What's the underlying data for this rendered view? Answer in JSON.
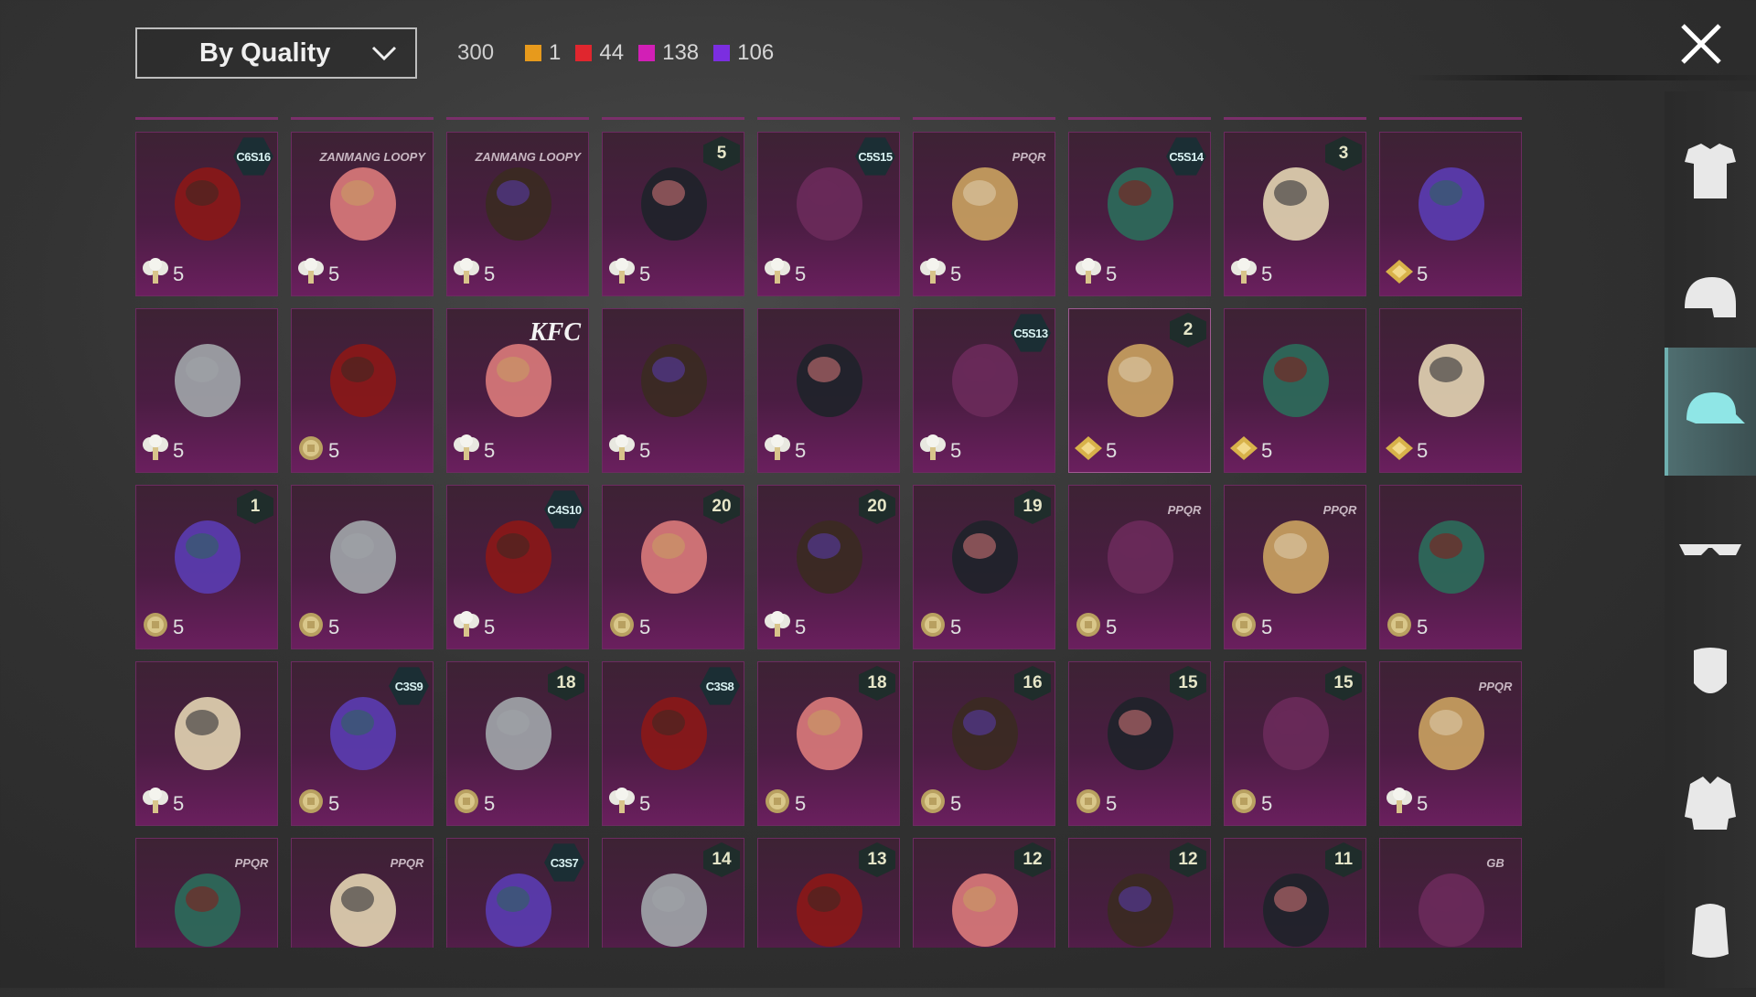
{
  "header": {
    "sort_label": "By Quality",
    "total": "300",
    "qualities": [
      {
        "color": "#e79a1c",
        "count": "1"
      },
      {
        "color": "#e0262e",
        "count": "44"
      },
      {
        "color": "#d21fb6",
        "count": "138"
      },
      {
        "color": "#7b2ee0",
        "count": "106"
      }
    ]
  },
  "items": [
    {
      "badge": "C6S16",
      "badge_type": "hex",
      "cost": "5",
      "currency": "tree",
      "icon": "red-hair-icon"
    },
    {
      "badge": "ZANMANG LOOPY",
      "badge_type": "brand",
      "cost": "5",
      "currency": "tree",
      "icon": "beaver-mask-icon"
    },
    {
      "badge": "ZANMANG LOOPY",
      "badge_type": "brand",
      "cost": "5",
      "currency": "tree",
      "icon": "beaver-mask-icon"
    },
    {
      "badge": "5",
      "badge_type": "lvl",
      "cost": "5",
      "currency": "tree",
      "icon": "long-hair-bow-icon"
    },
    {
      "badge": "C5S15",
      "badge_type": "hex",
      "cost": "5",
      "currency": "tree",
      "icon": "black-cap-icon"
    },
    {
      "badge": "PPQR",
      "badge_type": "brand",
      "cost": "5",
      "currency": "tree",
      "icon": "dark-hair-icon"
    },
    {
      "badge": "C5S14",
      "badge_type": "hex",
      "cost": "5",
      "currency": "tree",
      "icon": "purple-hair-icon"
    },
    {
      "badge": "3",
      "badge_type": "lvl",
      "cost": "5",
      "currency": "tree",
      "icon": "jester-hat-icon"
    },
    {
      "badge": "",
      "badge_type": "none",
      "cost": "5",
      "currency": "gem",
      "icon": "duck-head-arrow-icon"
    },
    {
      "badge": "",
      "badge_type": "none",
      "cost": "5",
      "currency": "tree",
      "icon": "wide-brim-hat-icon"
    },
    {
      "badge": "",
      "badge_type": "none",
      "cost": "5",
      "currency": "coin",
      "icon": "white-hair-icon"
    },
    {
      "badge": "KFC",
      "badge_type": "brand-kfc",
      "cost": "5",
      "currency": "tree",
      "icon": "chicken-cap-icon"
    },
    {
      "badge": "",
      "badge_type": "none",
      "cost": "5",
      "currency": "tree",
      "icon": "flower-hair-icon"
    },
    {
      "badge": "",
      "badge_type": "none",
      "cost": "5",
      "currency": "tree",
      "icon": "spiked-helmet-icon"
    },
    {
      "badge": "C5S13",
      "badge_type": "hex",
      "cost": "5",
      "currency": "tree",
      "icon": "green-beanie-icon"
    },
    {
      "badge": "2",
      "badge_type": "lvl",
      "cost": "5",
      "currency": "gem",
      "icon": "blonde-nurse-hat-icon"
    },
    {
      "badge": "",
      "badge_type": "none",
      "cost": "5",
      "currency": "gem",
      "icon": "goose-mask-icon"
    },
    {
      "badge": "",
      "badge_type": "none",
      "cost": "5",
      "currency": "gem",
      "icon": "potato-mask-icon"
    },
    {
      "badge": "1",
      "badge_type": "lvl",
      "cost": "5",
      "currency": "coin",
      "icon": "rainbow-hair-icon"
    },
    {
      "badge": "",
      "badge_type": "none",
      "cost": "5",
      "currency": "coin",
      "icon": "red-bow-headband-icon"
    },
    {
      "badge": "C4S10",
      "badge_type": "hex",
      "cost": "5",
      "currency": "tree",
      "icon": "green-helmet-icon"
    },
    {
      "badge": "20",
      "badge_type": "lvl",
      "cost": "5",
      "currency": "coin",
      "icon": "bunny-hair-icon"
    },
    {
      "badge": "20",
      "badge_type": "lvl",
      "cost": "5",
      "currency": "tree",
      "icon": "gold-mask-icon"
    },
    {
      "badge": "19",
      "badge_type": "lvl",
      "cost": "5",
      "currency": "coin",
      "icon": "black-bun-hair-icon"
    },
    {
      "badge": "PPQR",
      "badge_type": "brand",
      "cost": "5",
      "currency": "coin",
      "icon": "potato-head-icon"
    },
    {
      "badge": "PPQR",
      "badge_type": "brand",
      "cost": "5",
      "currency": "coin",
      "icon": "red-bob-hair-icon"
    },
    {
      "badge": "",
      "badge_type": "none",
      "cost": "5",
      "currency": "coin",
      "icon": "blue-demon-mask-icon"
    },
    {
      "badge": "",
      "badge_type": "none",
      "cost": "5",
      "currency": "tree",
      "icon": "luchador-mask-icon"
    },
    {
      "badge": "C3S9",
      "badge_type": "hex",
      "cost": "5",
      "currency": "coin",
      "icon": "purple-bandana-icon"
    },
    {
      "badge": "18",
      "badge_type": "lvl",
      "cost": "5",
      "currency": "coin",
      "icon": "uncle-sam-hat-icon"
    },
    {
      "badge": "C3S8",
      "badge_type": "hex",
      "cost": "5",
      "currency": "tree",
      "icon": "knit-cap-icon"
    },
    {
      "badge": "18",
      "badge_type": "lvl",
      "cost": "5",
      "currency": "coin",
      "icon": "black-hair-icon"
    },
    {
      "badge": "16",
      "badge_type": "lvl",
      "cost": "5",
      "currency": "coin",
      "icon": "peacock-hair-icon"
    },
    {
      "badge": "15",
      "badge_type": "lvl",
      "cost": "5",
      "currency": "coin",
      "icon": "bird-mask-icon"
    },
    {
      "badge": "15",
      "badge_type": "lvl",
      "cost": "5",
      "currency": "coin",
      "icon": "dreadlock-hair-icon"
    },
    {
      "badge": "PPQR",
      "badge_type": "brand",
      "cost": "5",
      "currency": "tree",
      "icon": "bomb-helmet-icon"
    },
    {
      "badge": "PPQR",
      "badge_type": "brand",
      "cost": "",
      "currency": "none",
      "icon": "octopus-mask-icon"
    },
    {
      "badge": "PPQR",
      "badge_type": "brand",
      "cost": "",
      "currency": "none",
      "icon": "snake-head-icon"
    },
    {
      "badge": "C3S7",
      "badge_type": "hex",
      "cost": "",
      "currency": "none",
      "icon": "blue-bird-icon"
    },
    {
      "badge": "14",
      "badge_type": "lvl",
      "cost": "",
      "currency": "none",
      "icon": "headband-hair-icon"
    },
    {
      "badge": "13",
      "badge_type": "lvl",
      "cost": "",
      "currency": "none",
      "icon": "devil-horns-icon"
    },
    {
      "badge": "12",
      "badge_type": "lvl",
      "cost": "",
      "currency": "none",
      "icon": "sponge-head-icon"
    },
    {
      "badge": "12",
      "badge_type": "lvl",
      "cost": "",
      "currency": "none",
      "icon": "spray-can-head-icon"
    },
    {
      "badge": "11",
      "badge_type": "lvl",
      "cost": "",
      "currency": "none",
      "icon": "blue-helmet-icon"
    },
    {
      "badge": "GB",
      "badge_type": "brand",
      "cost": "",
      "currency": "none",
      "icon": "teddy-bear-hat-icon"
    }
  ],
  "sidebar": [
    {
      "name": "outfit-icon"
    },
    {
      "name": "helmet-icon"
    },
    {
      "name": "cap-icon",
      "active": true
    },
    {
      "name": "glasses-icon"
    },
    {
      "name": "mask-icon"
    },
    {
      "name": "jacket-icon"
    },
    {
      "name": "backpack-icon"
    }
  ]
}
